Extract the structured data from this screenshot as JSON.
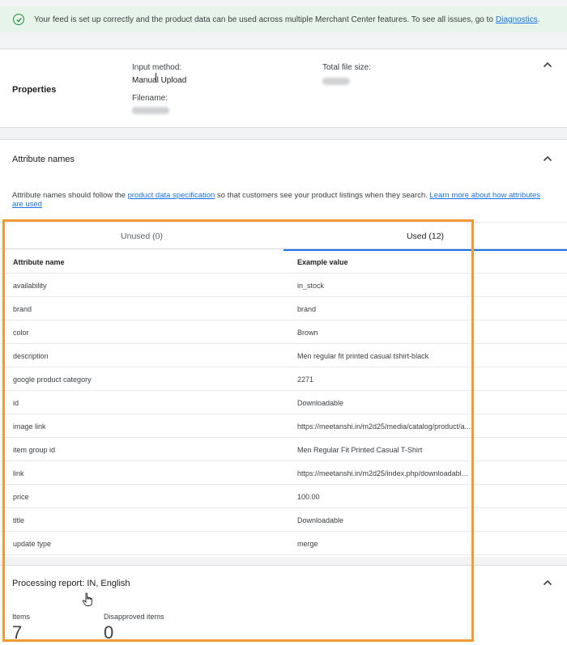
{
  "banner": {
    "message": "Your feed is set up correctly and the product data can be used across multiple Merchant Center features. To see all issues, go to",
    "link_label": "Diagnostics",
    "link_suffix": ".",
    "icon": "check-circle-icon"
  },
  "properties": {
    "title": "Properties",
    "input_method_label": "Input method:",
    "input_method_value": "Manual Upload",
    "filename_label": "Filename:",
    "total_file_size_label": "Total file size:"
  },
  "attributes": {
    "title": "Attribute names",
    "desc_prefix": "Attribute names should follow the",
    "spec_link": "product data specification",
    "desc_middle": "so that customers see your product listings when they search.",
    "learn_more_link": "Learn more about how attributes are used",
    "tabs": [
      {
        "label": "Unused (0)",
        "selected": false
      },
      {
        "label": "Used (12)",
        "selected": true
      }
    ],
    "columns": [
      "Attribute name",
      "Example value"
    ],
    "rows": [
      {
        "name": "availability",
        "example": "in_stock"
      },
      {
        "name": "brand",
        "example": "brand"
      },
      {
        "name": "color",
        "example": "Brown"
      },
      {
        "name": "description",
        "example": "Men regular fit printed casual tshirt-black"
      },
      {
        "name": "google product category",
        "example": "2271"
      },
      {
        "name": "id",
        "example": "Downloadable"
      },
      {
        "name": "image link",
        "example": "https://meetanshi.in/m2d25/media/catalog/product/a..."
      },
      {
        "name": "item group id",
        "example": "Men Regular Fit Printed Casual T-Shirt"
      },
      {
        "name": "link",
        "example": "https://meetanshi.in/m2d25/index.php/downloadable...."
      },
      {
        "name": "price",
        "example": "100.00"
      },
      {
        "name": "title",
        "example": "Downloadable"
      },
      {
        "name": "update type",
        "example": "merge"
      }
    ]
  },
  "report": {
    "title": "Processing report: IN, English",
    "items_label": "Items",
    "items_value": "7",
    "disapproved_label": "Disapproved items",
    "disapproved_value": "0"
  },
  "colors": {
    "accent": "#1a73e8",
    "success": "#1e8e3e",
    "banner_bg": "#e6f4ea",
    "highlight": "#f29a36"
  }
}
